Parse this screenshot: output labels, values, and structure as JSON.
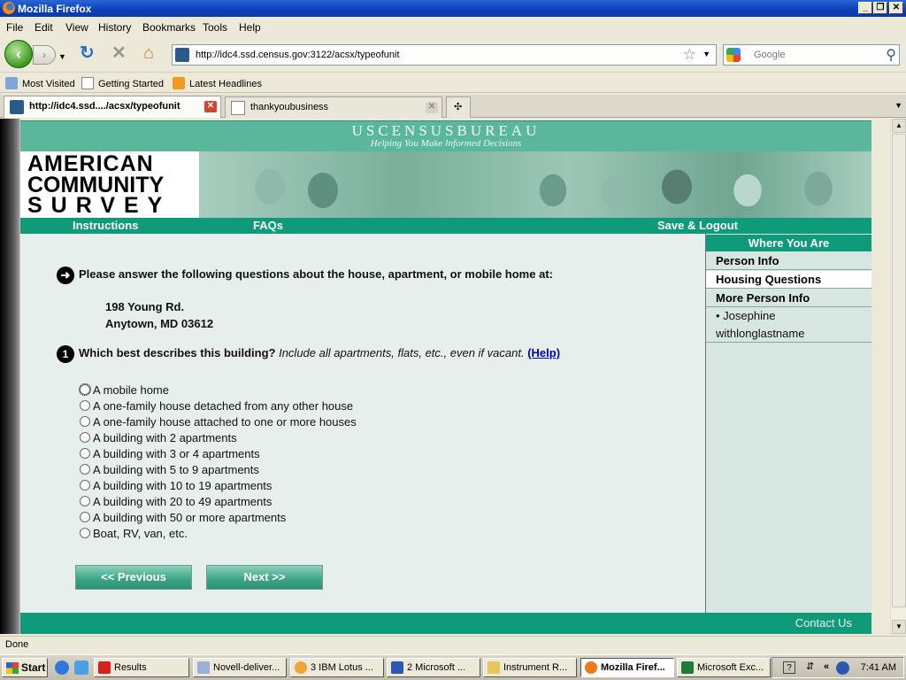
{
  "window": {
    "title": "Mozilla Firefox"
  },
  "menu": [
    "File",
    "Edit",
    "View",
    "History",
    "Bookmarks",
    "Tools",
    "Help"
  ],
  "nav": {
    "url": "http://idc4.ssd.census.gov:3122/acsx/typeofunit",
    "search_placeholder": "Google"
  },
  "bookmarks": [
    "Most Visited",
    "Getting Started",
    "Latest Headlines"
  ],
  "tabs": [
    {
      "label": "http://idc4.ssd..../acsx/typeofunit",
      "active": true
    },
    {
      "label": "thankyoubusiness",
      "active": false
    }
  ],
  "header": {
    "title": "USCENSUSBUREAU",
    "tagline": "Helping You Make Informed Decisions"
  },
  "logo": [
    "AMERICAN",
    "COMMUNITY",
    "SURVEY"
  ],
  "top_nav": {
    "instructions": "Instructions",
    "faqs": "FAQs",
    "save_logout": "Save & Logout"
  },
  "sidebar": {
    "heading": "Where You Are",
    "items": [
      "Person Info",
      "Housing Questions",
      "More Person Info"
    ],
    "sub_line1": "• Josephine",
    "sub_line2": "withlonglastname"
  },
  "question": {
    "intro": "Please answer the following questions about the house, apartment, or mobile home at:",
    "address_line1": "198 Young Rd.",
    "address_line2": "Anytown, MD 03612",
    "number": "1",
    "text": "Which best describes this building?",
    "instruction": "Include all apartments, flats, etc., even if vacant.",
    "help": "(Help)",
    "options": [
      "A mobile home",
      "A one-family house detached from any other house",
      "A one-family house attached to one or more houses",
      "A building with 2 apartments",
      "A building with 3 or 4 apartments",
      "A building with 5 to 9 apartments",
      "A building with 10 to 19 apartments",
      "A building with 20 to 49 apartments",
      "A building with 50 or more apartments",
      "Boat, RV, van, etc."
    ]
  },
  "buttons": {
    "previous": "<<   Previous",
    "next": "Next   >>"
  },
  "footer": {
    "contact": "Contact Us"
  },
  "status": "Done",
  "taskbar": {
    "start": "Start",
    "tasks": [
      "Results",
      "Novell-deliver...",
      "3 IBM Lotus ...",
      "2 Microsoft ...",
      "Instrument R...",
      "Mozilla Firef...",
      "Microsoft Exc..."
    ],
    "clock": "7:41 AM"
  }
}
